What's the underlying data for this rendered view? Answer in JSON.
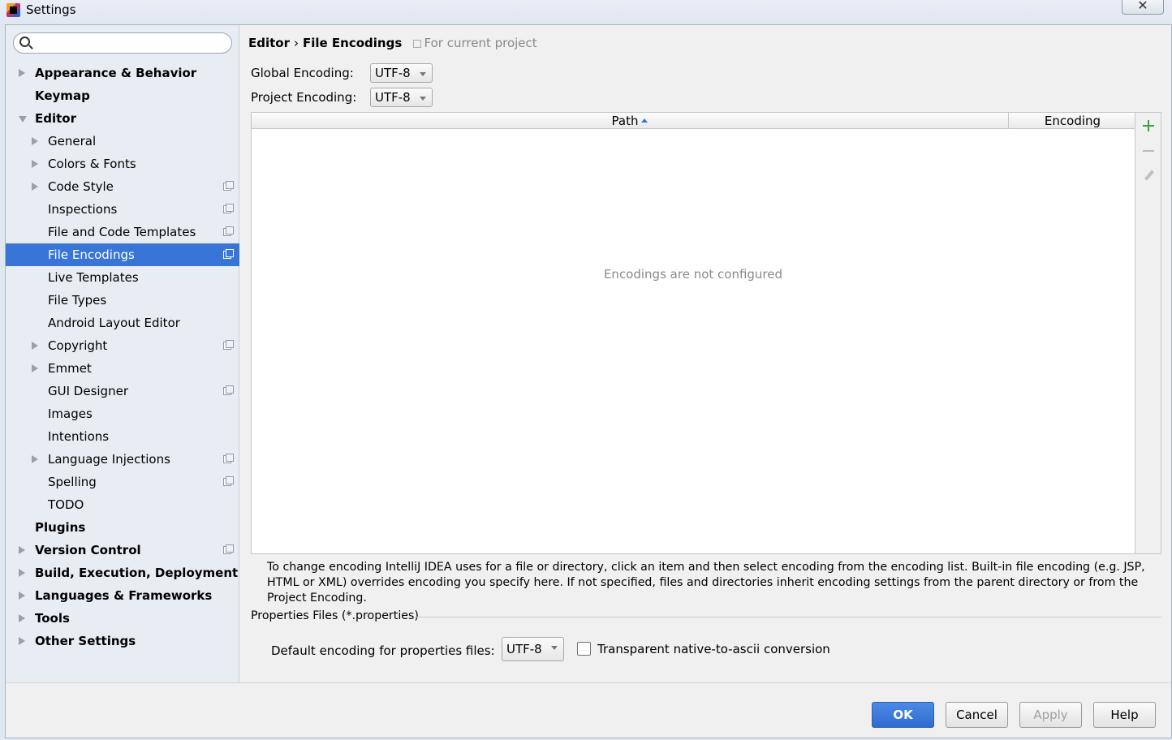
{
  "window": {
    "title": "Settings",
    "close_glyph": "✕"
  },
  "search": {
    "placeholder": ""
  },
  "sidebar": {
    "items": [
      {
        "label": "Appearance & Behavior",
        "level": 0,
        "bold": true,
        "arrow": "right",
        "project": false
      },
      {
        "label": "Keymap",
        "level": 0,
        "bold": true,
        "arrow": "none",
        "project": false
      },
      {
        "label": "Editor",
        "level": 0,
        "bold": true,
        "arrow": "down",
        "project": false
      },
      {
        "label": "General",
        "level": 1,
        "bold": false,
        "arrow": "right",
        "project": false
      },
      {
        "label": "Colors & Fonts",
        "level": 1,
        "bold": false,
        "arrow": "right",
        "project": false
      },
      {
        "label": "Code Style",
        "level": 1,
        "bold": false,
        "arrow": "right",
        "project": true
      },
      {
        "label": "Inspections",
        "level": 1,
        "bold": false,
        "arrow": "none",
        "project": true
      },
      {
        "label": "File and Code Templates",
        "level": 1,
        "bold": false,
        "arrow": "none",
        "project": true
      },
      {
        "label": "File Encodings",
        "level": 1,
        "bold": false,
        "arrow": "none",
        "project": true,
        "selected": true
      },
      {
        "label": "Live Templates",
        "level": 1,
        "bold": false,
        "arrow": "none",
        "project": false
      },
      {
        "label": "File Types",
        "level": 1,
        "bold": false,
        "arrow": "none",
        "project": false
      },
      {
        "label": "Android Layout Editor",
        "level": 1,
        "bold": false,
        "arrow": "none",
        "project": false
      },
      {
        "label": "Copyright",
        "level": 1,
        "bold": false,
        "arrow": "right",
        "project": true
      },
      {
        "label": "Emmet",
        "level": 1,
        "bold": false,
        "arrow": "right",
        "project": false
      },
      {
        "label": "GUI Designer",
        "level": 1,
        "bold": false,
        "arrow": "none",
        "project": true
      },
      {
        "label": "Images",
        "level": 1,
        "bold": false,
        "arrow": "none",
        "project": false
      },
      {
        "label": "Intentions",
        "level": 1,
        "bold": false,
        "arrow": "none",
        "project": false
      },
      {
        "label": "Language Injections",
        "level": 1,
        "bold": false,
        "arrow": "right",
        "project": true
      },
      {
        "label": "Spelling",
        "level": 1,
        "bold": false,
        "arrow": "none",
        "project": true
      },
      {
        "label": "TODO",
        "level": 1,
        "bold": false,
        "arrow": "none",
        "project": false
      },
      {
        "label": "Plugins",
        "level": 0,
        "bold": true,
        "arrow": "none",
        "project": false
      },
      {
        "label": "Version Control",
        "level": 0,
        "bold": true,
        "arrow": "right",
        "project": true
      },
      {
        "label": "Build, Execution, Deployment",
        "level": 0,
        "bold": true,
        "arrow": "right",
        "project": false
      },
      {
        "label": "Languages & Frameworks",
        "level": 0,
        "bold": true,
        "arrow": "right",
        "project": false
      },
      {
        "label": "Tools",
        "level": 0,
        "bold": true,
        "arrow": "right",
        "project": false
      },
      {
        "label": "Other Settings",
        "level": 0,
        "bold": true,
        "arrow": "right",
        "project": false
      }
    ]
  },
  "breadcrumb": {
    "section": "Editor",
    "separator": "›",
    "page": "File Encodings",
    "scope": "For current project"
  },
  "encoding": {
    "global_label": "Global Encoding:",
    "global_value": "UTF-8",
    "project_label": "Project Encoding:",
    "project_value": "UTF-8"
  },
  "table": {
    "columns": [
      "Path",
      "Encoding"
    ],
    "empty_text": "Encodings are not configured"
  },
  "info_text": "To change encoding IntelliJ IDEA uses for a file or directory, click an item and then select encoding from the encoding list. Built-in file encoding (e.g. JSP, HTML or XML) overrides encoding you specify here. If not specified, files and directories inherit encoding settings from the parent directory or from the Project Encoding.",
  "properties": {
    "group_title": "Properties Files (*.properties)",
    "default_label": "Default encoding for properties files:",
    "default_value": "UTF-8",
    "transparent_label": "Transparent native-to-ascii conversion",
    "transparent_checked": false
  },
  "buttons": {
    "ok": "OK",
    "cancel": "Cancel",
    "apply": "Apply",
    "help": "Help"
  },
  "colors": {
    "selection": "#3875d7",
    "add_icon": "#3da33d",
    "sidebar_bg": "#e8edf3"
  }
}
